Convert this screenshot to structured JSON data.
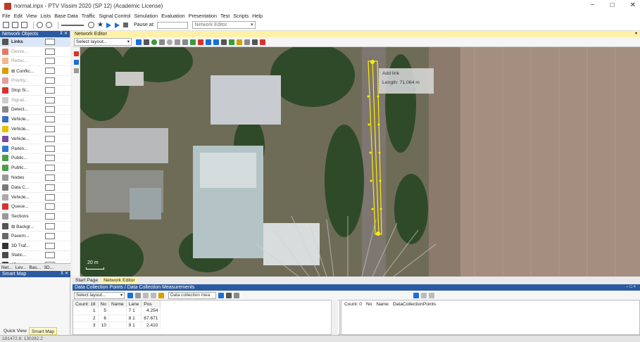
{
  "window": {
    "title": "normal.inpx - PTV Vissim 2020 (SP 12) (Academic License)",
    "controls": [
      "−",
      "□",
      "✕"
    ]
  },
  "menu": [
    "File",
    "Edit",
    "View",
    "Lists",
    "Base Data",
    "Traffic",
    "Signal Control",
    "Simulation",
    "Evaluation",
    "Presentation",
    "Test",
    "Scripts",
    "Help"
  ],
  "toolbar": {
    "pause_label": "Pause at:",
    "view_select": "Network Editor"
  },
  "network_objects": {
    "header": "Network Objects",
    "header_controls": "⊼ ✕",
    "items": [
      {
        "label": "Links",
        "icon_color": "#555555",
        "selected": true,
        "dim": false
      },
      {
        "label": "Desire...",
        "icon_color": "#e27a6a",
        "selected": false,
        "dim": true
      },
      {
        "label": "Reduc...",
        "icon_color": "#f2b88a",
        "selected": false,
        "dim": true
      },
      {
        "label": "⊞ Conflic...",
        "icon_color": "#d5a000",
        "selected": false,
        "dim": false
      },
      {
        "label": "Priority...",
        "icon_color": "#e0a0a0",
        "selected": false,
        "dim": true
      },
      {
        "label": "Stop Si...",
        "icon_color": "#d9322a",
        "selected": false,
        "dim": false
      },
      {
        "label": "Signal...",
        "icon_color": "#cccccc",
        "selected": false,
        "dim": true
      },
      {
        "label": "Detect...",
        "icon_color": "#888888",
        "selected": false,
        "dim": false
      },
      {
        "label": "Vehicle...",
        "icon_color": "#3a6fc4",
        "selected": false,
        "dim": false
      },
      {
        "label": "Vehicle...",
        "icon_color": "#e8c000",
        "selected": false,
        "dim": false
      },
      {
        "label": "Vehicle...",
        "icon_color": "#7a4aa0",
        "selected": false,
        "dim": false
      },
      {
        "label": "Parkin...",
        "icon_color": "#2c7ad6",
        "selected": false,
        "dim": false
      },
      {
        "label": "Public...",
        "icon_color": "#4aa04a",
        "selected": false,
        "dim": false
      },
      {
        "label": "Public...",
        "icon_color": "#4aa04a",
        "selected": false,
        "dim": false
      },
      {
        "label": "Nodes",
        "icon_color": "#999999",
        "selected": false,
        "dim": false
      },
      {
        "label": "Data C...",
        "icon_color": "#777777",
        "selected": false,
        "dim": false
      },
      {
        "label": "Vehicle...",
        "icon_color": "#aaaaaa",
        "selected": false,
        "dim": false
      },
      {
        "label": "Queue...",
        "icon_color": "#d9322a",
        "selected": false,
        "dim": false
      },
      {
        "label": "Sections",
        "icon_color": "#999999",
        "selected": false,
        "dim": false
      },
      {
        "label": "⊞ Backgr...",
        "icon_color": "#555555",
        "selected": false,
        "dim": false
      },
      {
        "label": "Pavem...",
        "icon_color": "#666666",
        "selected": false,
        "dim": false
      },
      {
        "label": "3D Traf...",
        "icon_color": "#333333",
        "selected": false,
        "dim": false
      },
      {
        "label": "Static...",
        "icon_color": "#4a4a4a",
        "selected": false,
        "dim": false
      },
      {
        "label": "3D Int...",
        "icon_color": "#3a3a3a",
        "selected": false,
        "dim": false
      }
    ],
    "tabs": [
      "Net...",
      "Lev...",
      "Bac...",
      "3D..."
    ]
  },
  "smart_map": {
    "header": "Smart Map",
    "tabs": [
      "Quick View",
      "Smart Map"
    ]
  },
  "status": {
    "coords": "181472.8; 130282.2"
  },
  "network_editor": {
    "header": "Network Editor",
    "layout_select": "Select layout...",
    "tooltip": {
      "line1": "Add link",
      "line2": "Length:   71.064 m"
    },
    "scale_label": "20 m"
  },
  "doc_tabs": [
    "Start Page",
    "Network Editor"
  ],
  "data_collection": {
    "header": "Data Collection Points / Data Collection Measurements",
    "layout_select": "Select layout...",
    "measure_select": "Data collection mea",
    "columns": [
      "Count: 18",
      "No",
      "Name",
      "Lane",
      "Pos"
    ],
    "rows": [
      [
        "1",
        "5",
        "",
        "7 1",
        "4.254"
      ],
      [
        "2",
        "6",
        "",
        "8 1",
        "67.671"
      ],
      [
        "3",
        "10",
        "",
        "9 1",
        "2.410"
      ]
    ],
    "right_columns": [
      "Count: 0",
      "No",
      "Name",
      "DataCollectionPoints"
    ]
  }
}
